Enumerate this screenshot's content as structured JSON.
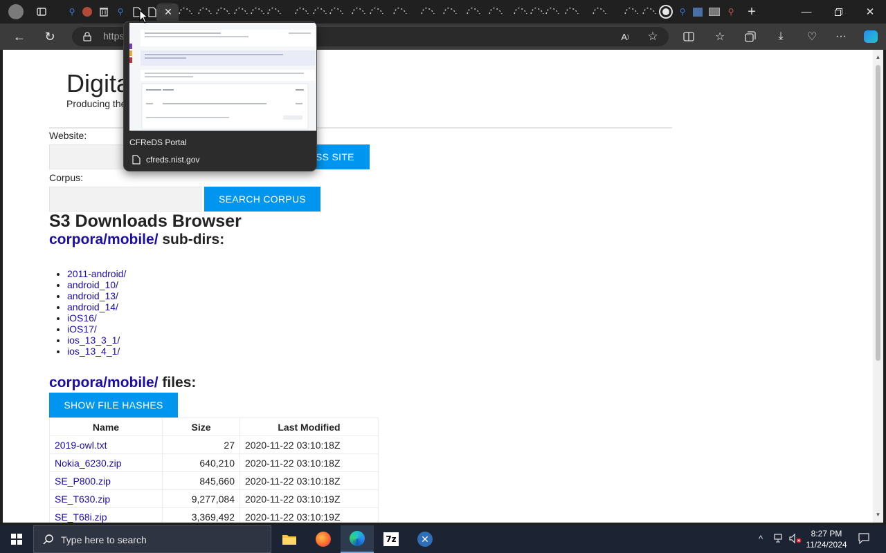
{
  "browser": {
    "address_partial": "https:",
    "tab_preview": {
      "title": "CFReDS Portal",
      "url": "cfreds.nist.gov"
    }
  },
  "page": {
    "site_title": "Digita",
    "site_subtitle": "Producing the",
    "website_label": "Website:",
    "access_site_button": "SS SITE",
    "corpus_label": "Corpus:",
    "search_corpus_button": "SEARCH CORPUS",
    "browser_heading": "S3 Downloads Browser",
    "subdirs_path": "corpora/mobile/",
    "subdirs_suffix": " sub-dirs:",
    "subdirs": [
      "2011-android/",
      "android_10/",
      "android_13/",
      "android_14/",
      "iOS16/",
      "iOS17/",
      "ios_13_3_1/",
      "ios_13_4_1/"
    ],
    "files_path": "corpora/mobile/",
    "files_suffix": " files:",
    "show_hashes_button": "SHOW FILE HASHES",
    "table": {
      "headers": [
        "Name",
        "Size",
        "Last Modified"
      ],
      "rows": [
        [
          "2019-owl.txt",
          "27",
          "2020-11-22 03:10:18Z"
        ],
        [
          "Nokia_6230.zip",
          "640,210",
          "2020-11-22 03:10:18Z"
        ],
        [
          "SE_P800.zip",
          "845,660",
          "2020-11-22 03:10:18Z"
        ],
        [
          "SE_T630.zip",
          "9,277,084",
          "2020-11-22 03:10:19Z"
        ],
        [
          "SE_T68i.zip",
          "3,369,492",
          "2020-11-22 03:10:19Z"
        ]
      ]
    }
  },
  "taskbar": {
    "search_placeholder": "Type here to search",
    "time": "8:27 PM",
    "date": "11/24/2024",
    "apps": [
      "file-explorer",
      "firefox",
      "edge",
      "7zip",
      "tool"
    ]
  },
  "colors": {
    "link": "#1a0dab",
    "button_blue": "#0096ef",
    "taskbar": "#1c2433"
  }
}
